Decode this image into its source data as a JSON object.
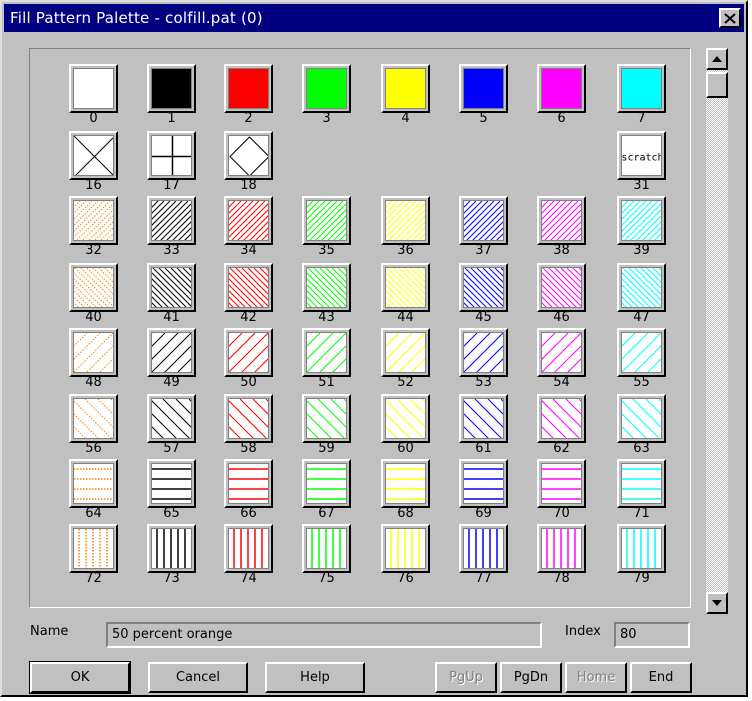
{
  "window": {
    "title": "Fill Pattern Palette - colfill.pat (0)",
    "close_icon": "close-x-icon"
  },
  "palette": {
    "swatches": [
      {
        "index": "0",
        "pattern": "solid",
        "color": "#ffffff"
      },
      {
        "index": "1",
        "pattern": "solid",
        "color": "#000000"
      },
      {
        "index": "2",
        "pattern": "solid",
        "color": "#ff0000"
      },
      {
        "index": "3",
        "pattern": "solid",
        "color": "#00ff00"
      },
      {
        "index": "4",
        "pattern": "solid",
        "color": "#ffff00"
      },
      {
        "index": "5",
        "pattern": "solid",
        "color": "#0000ff"
      },
      {
        "index": "6",
        "pattern": "solid",
        "color": "#ff00ff"
      },
      {
        "index": "7",
        "pattern": "solid",
        "color": "#00ffff"
      },
      {
        "index": "16",
        "pattern": "x-cross",
        "color": "#000000"
      },
      {
        "index": "17",
        "pattern": "plus-cross",
        "color": "#000000"
      },
      {
        "index": "18",
        "pattern": "diamond",
        "color": "#000000"
      },
      {
        "index": "31",
        "pattern": "text",
        "color": "#000000",
        "text": "scratch"
      },
      {
        "index": "32",
        "pattern": "diag-up-dense-dotted",
        "color": "#ff8000"
      },
      {
        "index": "33",
        "pattern": "diag-up-dense",
        "color": "#000000"
      },
      {
        "index": "34",
        "pattern": "diag-up-dense",
        "color": "#ff0000"
      },
      {
        "index": "35",
        "pattern": "diag-up-dense",
        "color": "#00ff00"
      },
      {
        "index": "36",
        "pattern": "diag-up-dense",
        "color": "#ffff00"
      },
      {
        "index": "37",
        "pattern": "diag-up-dense",
        "color": "#0000ff"
      },
      {
        "index": "38",
        "pattern": "diag-up-dense",
        "color": "#ff00ff"
      },
      {
        "index": "39",
        "pattern": "diag-up-dense",
        "color": "#00ffff"
      },
      {
        "index": "40",
        "pattern": "diag-down-dense-dotted",
        "color": "#ff8000"
      },
      {
        "index": "41",
        "pattern": "diag-down-dense",
        "color": "#000000"
      },
      {
        "index": "42",
        "pattern": "diag-down-dense",
        "color": "#ff0000"
      },
      {
        "index": "43",
        "pattern": "diag-down-dense",
        "color": "#00ff00"
      },
      {
        "index": "44",
        "pattern": "diag-down-dense",
        "color": "#ffff00"
      },
      {
        "index": "45",
        "pattern": "diag-down-dense",
        "color": "#0000ff"
      },
      {
        "index": "46",
        "pattern": "diag-down-dense",
        "color": "#ff00ff"
      },
      {
        "index": "47",
        "pattern": "diag-down-dense",
        "color": "#00ffff"
      },
      {
        "index": "48",
        "pattern": "diag-up-sparse-dotted",
        "color": "#ff8000"
      },
      {
        "index": "49",
        "pattern": "diag-up-sparse",
        "color": "#000000"
      },
      {
        "index": "50",
        "pattern": "diag-up-sparse",
        "color": "#ff0000"
      },
      {
        "index": "51",
        "pattern": "diag-up-sparse",
        "color": "#00ff00"
      },
      {
        "index": "52",
        "pattern": "diag-up-sparse",
        "color": "#ffff00"
      },
      {
        "index": "53",
        "pattern": "diag-up-sparse",
        "color": "#0000ff"
      },
      {
        "index": "54",
        "pattern": "diag-up-sparse",
        "color": "#ff00ff"
      },
      {
        "index": "55",
        "pattern": "diag-up-sparse",
        "color": "#00ffff"
      },
      {
        "index": "56",
        "pattern": "diag-down-sparse-dotted",
        "color": "#ff8000"
      },
      {
        "index": "57",
        "pattern": "diag-down-sparse",
        "color": "#000000"
      },
      {
        "index": "58",
        "pattern": "diag-down-sparse",
        "color": "#ff0000"
      },
      {
        "index": "59",
        "pattern": "diag-down-sparse",
        "color": "#00ff00"
      },
      {
        "index": "60",
        "pattern": "diag-down-sparse",
        "color": "#ffff00"
      },
      {
        "index": "61",
        "pattern": "diag-down-sparse",
        "color": "#0000ff"
      },
      {
        "index": "62",
        "pattern": "diag-down-sparse",
        "color": "#ff00ff"
      },
      {
        "index": "63",
        "pattern": "diag-down-sparse",
        "color": "#00ffff"
      },
      {
        "index": "64",
        "pattern": "horizontal-dotted",
        "color": "#ff8000"
      },
      {
        "index": "65",
        "pattern": "horizontal",
        "color": "#000000"
      },
      {
        "index": "66",
        "pattern": "horizontal",
        "color": "#ff0000"
      },
      {
        "index": "67",
        "pattern": "horizontal",
        "color": "#00ff00"
      },
      {
        "index": "68",
        "pattern": "horizontal",
        "color": "#ffff00"
      },
      {
        "index": "69",
        "pattern": "horizontal",
        "color": "#0000ff"
      },
      {
        "index": "70",
        "pattern": "horizontal",
        "color": "#ff00ff"
      },
      {
        "index": "71",
        "pattern": "horizontal",
        "color": "#00ffff"
      },
      {
        "index": "72",
        "pattern": "vertical-dotted",
        "color": "#ff8000"
      },
      {
        "index": "73",
        "pattern": "vertical",
        "color": "#000000"
      },
      {
        "index": "74",
        "pattern": "vertical",
        "color": "#ff0000"
      },
      {
        "index": "75",
        "pattern": "vertical",
        "color": "#00ff00"
      },
      {
        "index": "76",
        "pattern": "vertical",
        "color": "#ffff00"
      },
      {
        "index": "77",
        "pattern": "vertical",
        "color": "#0000ff"
      },
      {
        "index": "78",
        "pattern": "vertical",
        "color": "#ff00ff"
      },
      {
        "index": "79",
        "pattern": "vertical",
        "color": "#00ffff"
      }
    ]
  },
  "scrollbar": {
    "up_icon": "scroll-up-arrow-icon",
    "down_icon": "scroll-down-arrow-icon"
  },
  "name_field": {
    "label": "Name",
    "value": "50 percent orange"
  },
  "index_field": {
    "label": "Index",
    "value": "80"
  },
  "buttons": {
    "ok": "OK",
    "cancel": "Cancel",
    "help": "Help",
    "pgup": "PgUp",
    "pgdn": "PgDn",
    "home": "Home",
    "end": "End"
  }
}
